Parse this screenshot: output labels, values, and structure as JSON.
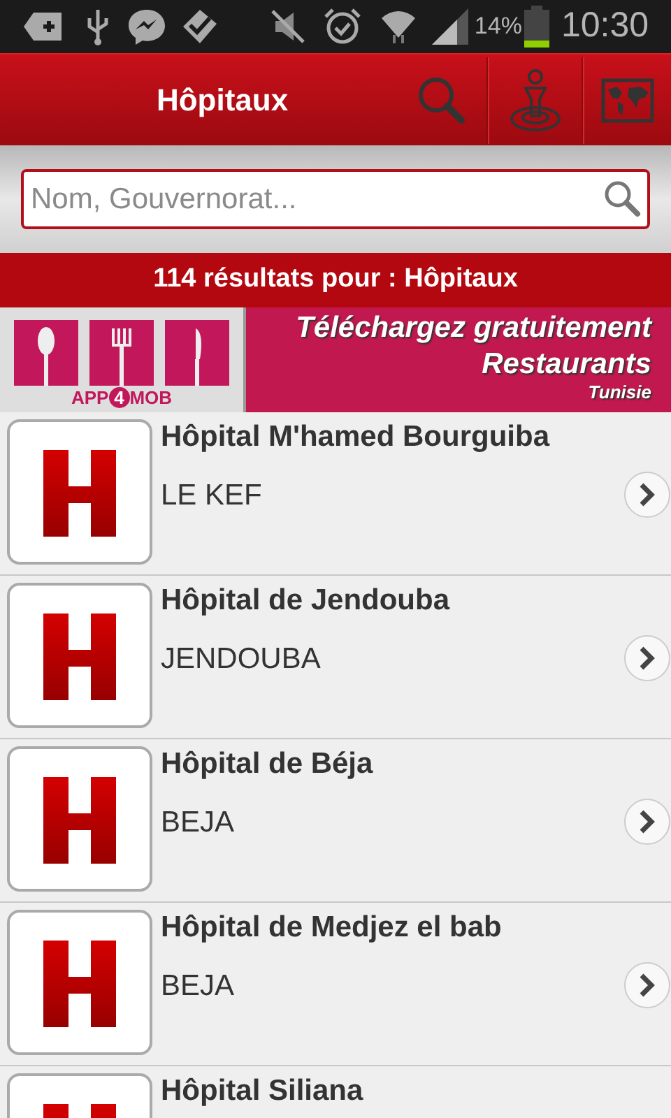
{
  "status_bar": {
    "battery": "14%",
    "time": "10:30"
  },
  "header": {
    "title": "Hôpitaux"
  },
  "search": {
    "placeholder": "Nom, Gouvernorat..."
  },
  "results_bar": {
    "text": "114 résultats pour : Hôpitaux"
  },
  "ad_banner": {
    "logo_left": "APP",
    "logo_digit": "4",
    "logo_right": "MOB",
    "headline": "Téléchargez gratuitement",
    "title": "Restaurants",
    "subtitle": "Tunisie"
  },
  "hospitals": [
    {
      "name": "Hôpital M'hamed Bourguiba",
      "region": "LE KEF"
    },
    {
      "name": "Hôpital de Jendouba",
      "region": "JENDOUBA"
    },
    {
      "name": "Hôpital de Béja",
      "region": "BEJA"
    },
    {
      "name": "Hôpital de Medjez el bab",
      "region": "BEJA"
    },
    {
      "name": "Hôpital Siliana"
    }
  ]
}
